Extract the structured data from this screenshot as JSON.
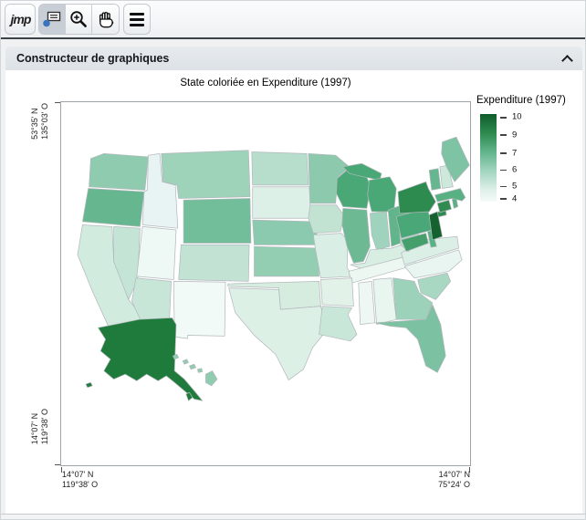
{
  "toolbar": {
    "logo_label": "jmp",
    "icons": [
      "jmp-logo",
      "annotation-tool-icon",
      "zoom-in-icon",
      "hand-icon",
      "menu-icon"
    ],
    "selected_tool": "annotation-tool"
  },
  "panel": {
    "title": "Constructeur de graphiques",
    "collapse_icon": "chevron-up"
  },
  "chart_data": {
    "type": "choropleth",
    "title": "State coloriée en Expenditure (1997)",
    "map_of": "United States",
    "y_axis": {
      "top": [
        "53°35' N",
        "135°03' O"
      ],
      "bottom": [
        "14°07' N",
        "119°38' O"
      ]
    },
    "x_axis": {
      "left": [
        "14°07' N",
        "119°38' O"
      ],
      "right": [
        "14°07' N",
        "75°24' O"
      ]
    },
    "legend": {
      "title": "Expenditure (1997)",
      "ticks": [
        {
          "label": "10",
          "pos": 0.04
        },
        {
          "label": "9",
          "pos": 0.24
        },
        {
          "label": "7",
          "pos": 0.45
        },
        {
          "label": "6",
          "pos": 0.64
        },
        {
          "label": "5",
          "pos": 0.83
        },
        {
          "label": "4",
          "pos": 0.97
        }
      ],
      "gradient": [
        "#0f5c2b",
        "#2e8b4f",
        "#66b790",
        "#a5d6c1",
        "#ddefe8",
        "#f5fbfa"
      ]
    },
    "states": [
      {
        "id": "WA",
        "color": "#8ecbaf"
      },
      {
        "id": "OR",
        "color": "#66b790"
      },
      {
        "id": "CA",
        "color": "#d2ebdf"
      },
      {
        "id": "NV",
        "color": "#c4e4d6"
      },
      {
        "id": "ID",
        "color": "#e8f3f4"
      },
      {
        "id": "MT",
        "color": "#9ed2b9"
      },
      {
        "id": "WY",
        "color": "#72bd9a"
      },
      {
        "id": "UT",
        "color": "#eef8f5"
      },
      {
        "id": "CO",
        "color": "#c2e3d4"
      },
      {
        "id": "AZ",
        "color": "#c8e6d8"
      },
      {
        "id": "NM",
        "color": "#f2faf7"
      },
      {
        "id": "ND",
        "color": "#b7ddcc"
      },
      {
        "id": "SD",
        "color": "#ddf0e8"
      },
      {
        "id": "NE",
        "color": "#8ccab0"
      },
      {
        "id": "KS",
        "color": "#93ceb3"
      },
      {
        "id": "OK",
        "color": "#d6ecdf"
      },
      {
        "id": "TX",
        "color": "#ddf0e6"
      },
      {
        "id": "MN",
        "color": "#8cc9ad"
      },
      {
        "id": "IA",
        "color": "#c2e2d2"
      },
      {
        "id": "MO",
        "color": "#d9eee4"
      },
      {
        "id": "WI",
        "color": "#4aa876"
      },
      {
        "id": "IL",
        "color": "#6cb994"
      },
      {
        "id": "MI",
        "color": "#4aa876"
      },
      {
        "id": "IN",
        "color": "#a0d3bd"
      },
      {
        "id": "OH",
        "color": "#62b58b"
      },
      {
        "id": "KY",
        "color": "#d8eee2"
      },
      {
        "id": "TN",
        "color": "#edf7f2"
      },
      {
        "id": "AR",
        "color": "#e2f2e9"
      },
      {
        "id": "MS",
        "color": "#eef7f3"
      },
      {
        "id": "AL",
        "color": "#e9f5ef"
      },
      {
        "id": "LA",
        "color": "#c9e7d9"
      },
      {
        "id": "GA",
        "color": "#9dd2ba"
      },
      {
        "id": "FL",
        "color": "#7cc2a2"
      },
      {
        "id": "SC",
        "color": "#a8d7c2"
      },
      {
        "id": "NC",
        "color": "#e9f5f1"
      },
      {
        "id": "VA",
        "color": "#dcefe7"
      },
      {
        "id": "WV",
        "color": "#b5dcca"
      },
      {
        "id": "PA",
        "color": "#4aa878"
      },
      {
        "id": "NY",
        "color": "#2e8b4f"
      },
      {
        "id": "NJ",
        "color": "#14632f"
      },
      {
        "id": "MD",
        "color": "#459f6b"
      },
      {
        "id": "DE",
        "color": "#56b183"
      },
      {
        "id": "CT",
        "color": "#2f8b50"
      },
      {
        "id": "RI",
        "color": "#58b083"
      },
      {
        "id": "MA",
        "color": "#58b083"
      },
      {
        "id": "VT",
        "color": "#66b78f"
      },
      {
        "id": "NH",
        "color": "#cde9db"
      },
      {
        "id": "ME",
        "color": "#7dc3a4"
      },
      {
        "id": "AK",
        "color": "#1e7b3b"
      },
      {
        "id": "HI",
        "color": "#8fccb0"
      }
    ]
  }
}
